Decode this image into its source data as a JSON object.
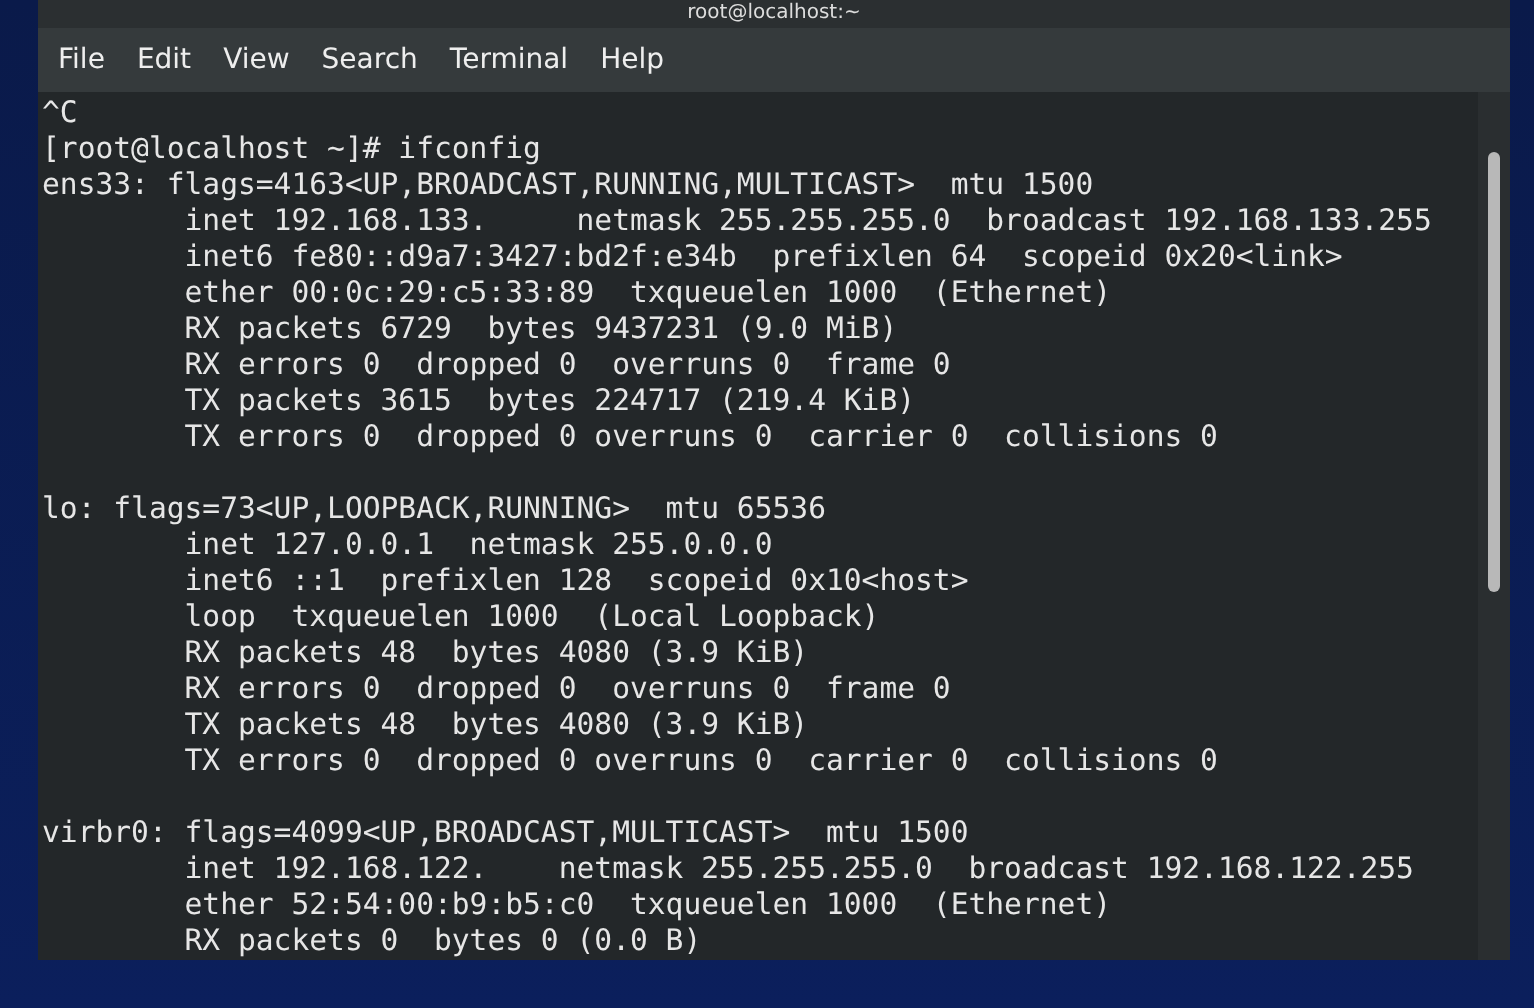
{
  "window": {
    "title": "root@localhost:~"
  },
  "menu": [
    "File",
    "Edit",
    "View",
    "Search",
    "Terminal",
    "Help"
  ],
  "terminal": {
    "blocks": [
      {
        "lines": [
          "^C",
          "[root@localhost ~]# ifconfig",
          "ens33: flags=4163<UP,BROADCAST,RUNNING,MULTICAST>  mtu 1500",
          "        inet 192.168.133.     netmask 255.255.255.0  broadcast 192.168.133.255",
          "        inet6 fe80::d9a7:3427:bd2f:e34b  prefixlen 64  scopeid 0x20<link>",
          "        ether 00:0c:29:c5:33:89  txqueuelen 1000  (Ethernet)",
          "        RX packets 6729  bytes 9437231 (9.0 MiB)",
          "        RX errors 0  dropped 0  overruns 0  frame 0",
          "        TX packets 3615  bytes 224717 (219.4 KiB)",
          "        TX errors 0  dropped 0 overruns 0  carrier 0  collisions 0"
        ]
      },
      {
        "lines": [
          "lo: flags=73<UP,LOOPBACK,RUNNING>  mtu 65536",
          "        inet 127.0.0.1  netmask 255.0.0.0",
          "        inet6 ::1  prefixlen 128  scopeid 0x10<host>",
          "        loop  txqueuelen 1000  (Local Loopback)",
          "        RX packets 48  bytes 4080 (3.9 KiB)",
          "        RX errors 0  dropped 0  overruns 0  frame 0",
          "        TX packets 48  bytes 4080 (3.9 KiB)",
          "        TX errors 0  dropped 0 overruns 0  carrier 0  collisions 0"
        ]
      },
      {
        "lines": [
          "virbr0: flags=4099<UP,BROADCAST,MULTICAST>  mtu 1500",
          "        inet 192.168.122.    netmask 255.255.255.0  broadcast 192.168.122.255",
          "        ether 52:54:00:b9:b5:c0  txqueuelen 1000  (Ethernet)",
          "        RX packets 0  bytes 0 (0.0 B)"
        ]
      }
    ]
  }
}
